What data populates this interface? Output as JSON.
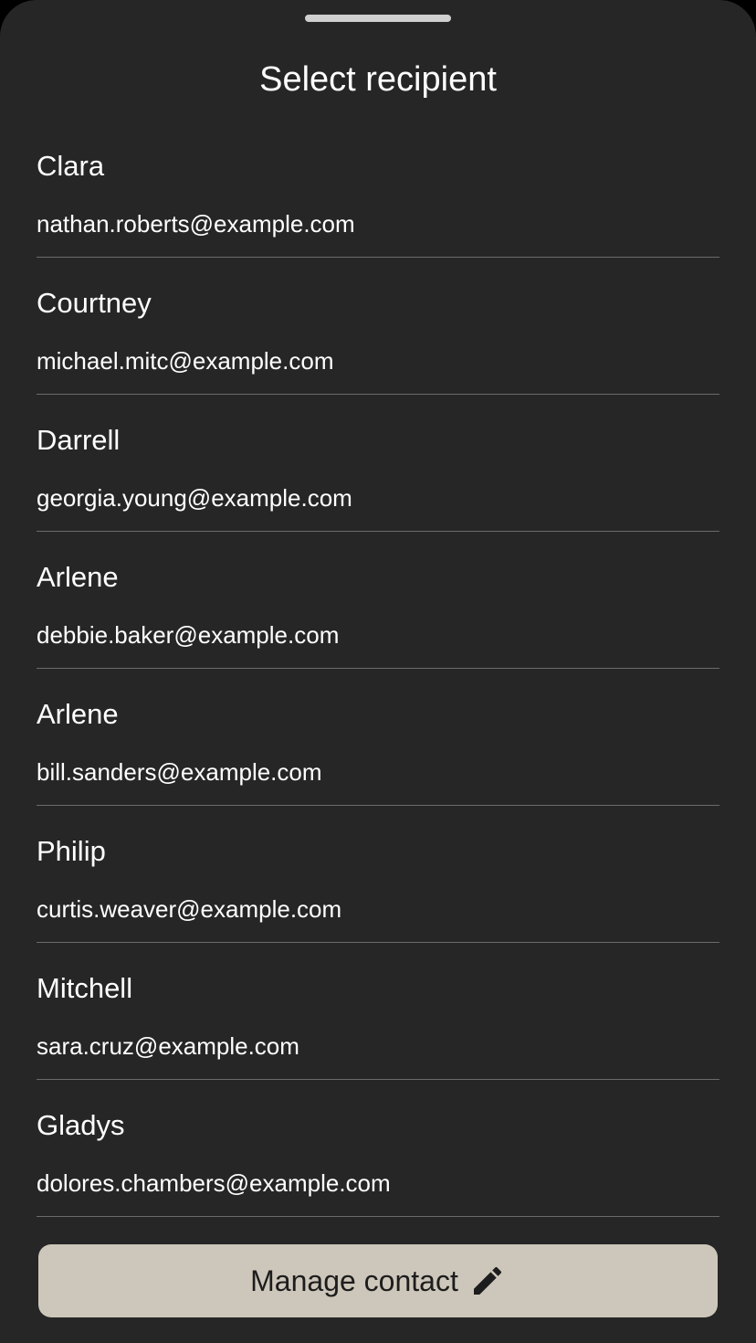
{
  "sheet": {
    "title": "Select recipient"
  },
  "recipients": [
    {
      "name": "Clara",
      "email": "nathan.roberts@example.com"
    },
    {
      "name": "Courtney",
      "email": "michael.mitc@example.com"
    },
    {
      "name": "Darrell",
      "email": "georgia.young@example.com"
    },
    {
      "name": "Arlene",
      "email": "debbie.baker@example.com"
    },
    {
      "name": "Arlene",
      "email": "bill.sanders@example.com"
    },
    {
      "name": "Philip",
      "email": "curtis.weaver@example.com"
    },
    {
      "name": "Mitchell",
      "email": "sara.cruz@example.com"
    },
    {
      "name": "Gladys",
      "email": "dolores.chambers@example.com"
    }
  ],
  "footer": {
    "manage_label": "Manage contact",
    "manage_icon": "pencil-icon"
  },
  "colors": {
    "sheet_background": "#262626",
    "button_background": "#cdc6ba",
    "divider": "#6b6b6b",
    "text": "#ffffff"
  }
}
